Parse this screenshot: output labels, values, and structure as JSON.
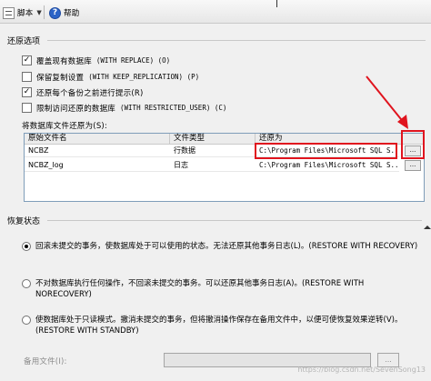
{
  "toolbar": {
    "script_label": "脚本",
    "help_label": "帮助"
  },
  "restore_options": {
    "title": "还原选项",
    "options": [
      {
        "label": "覆盖现有数据库",
        "code": "(WITH REPLACE) (O)",
        "checked": true
      },
      {
        "label": "保留复制设置",
        "code": "(WITH KEEP_REPLICATION) (P)",
        "checked": false
      },
      {
        "label": "还原每个备份之前进行提示(R)",
        "code": "",
        "checked": true
      },
      {
        "label": "限制访问还原的数据库",
        "code": "(WITH RESTRICTED_USER) (C)",
        "checked": false
      }
    ]
  },
  "restore_files": {
    "label": "将数据库文件还原为(S):",
    "columns": [
      "原始文件名",
      "文件类型",
      "还原为"
    ],
    "rows": [
      {
        "name": "NCBZ",
        "type": "行数据",
        "path": "C:\\Program Files\\Microsoft SQL S...",
        "button": "..."
      },
      {
        "name": "NCBZ_log",
        "type": "日志",
        "path": "C:\\Program Files\\Microsoft SQL S...",
        "button": "..."
      }
    ]
  },
  "recovery_state": {
    "title": "恢复状态",
    "options": [
      {
        "text": "回滚未提交的事务，使数据库处于可以使用的状态。无法还原其他事务日志(L)。(RESTORE WITH RECOVERY)",
        "selected": true
      },
      {
        "text": "不对数据库执行任何操作，不回滚未提交的事务。可以还原其他事务日志(A)。(RESTORE WITH NORECOVERY)",
        "selected": false
      },
      {
        "text": "使数据库处于只读模式。撤消未提交的事务，但将撤消操作保存在备用文件中，以便可使恢复效果逆转(V)。(RESTORE WITH STANDBY)",
        "selected": false
      }
    ],
    "standby_file_label": "备用文件(I):",
    "standby_button": "..."
  },
  "watermark": "https://blog.csdn.net/SevenSong13",
  "colors": {
    "highlight_red": "#e0141e",
    "arrow_red": "#e0141e"
  }
}
